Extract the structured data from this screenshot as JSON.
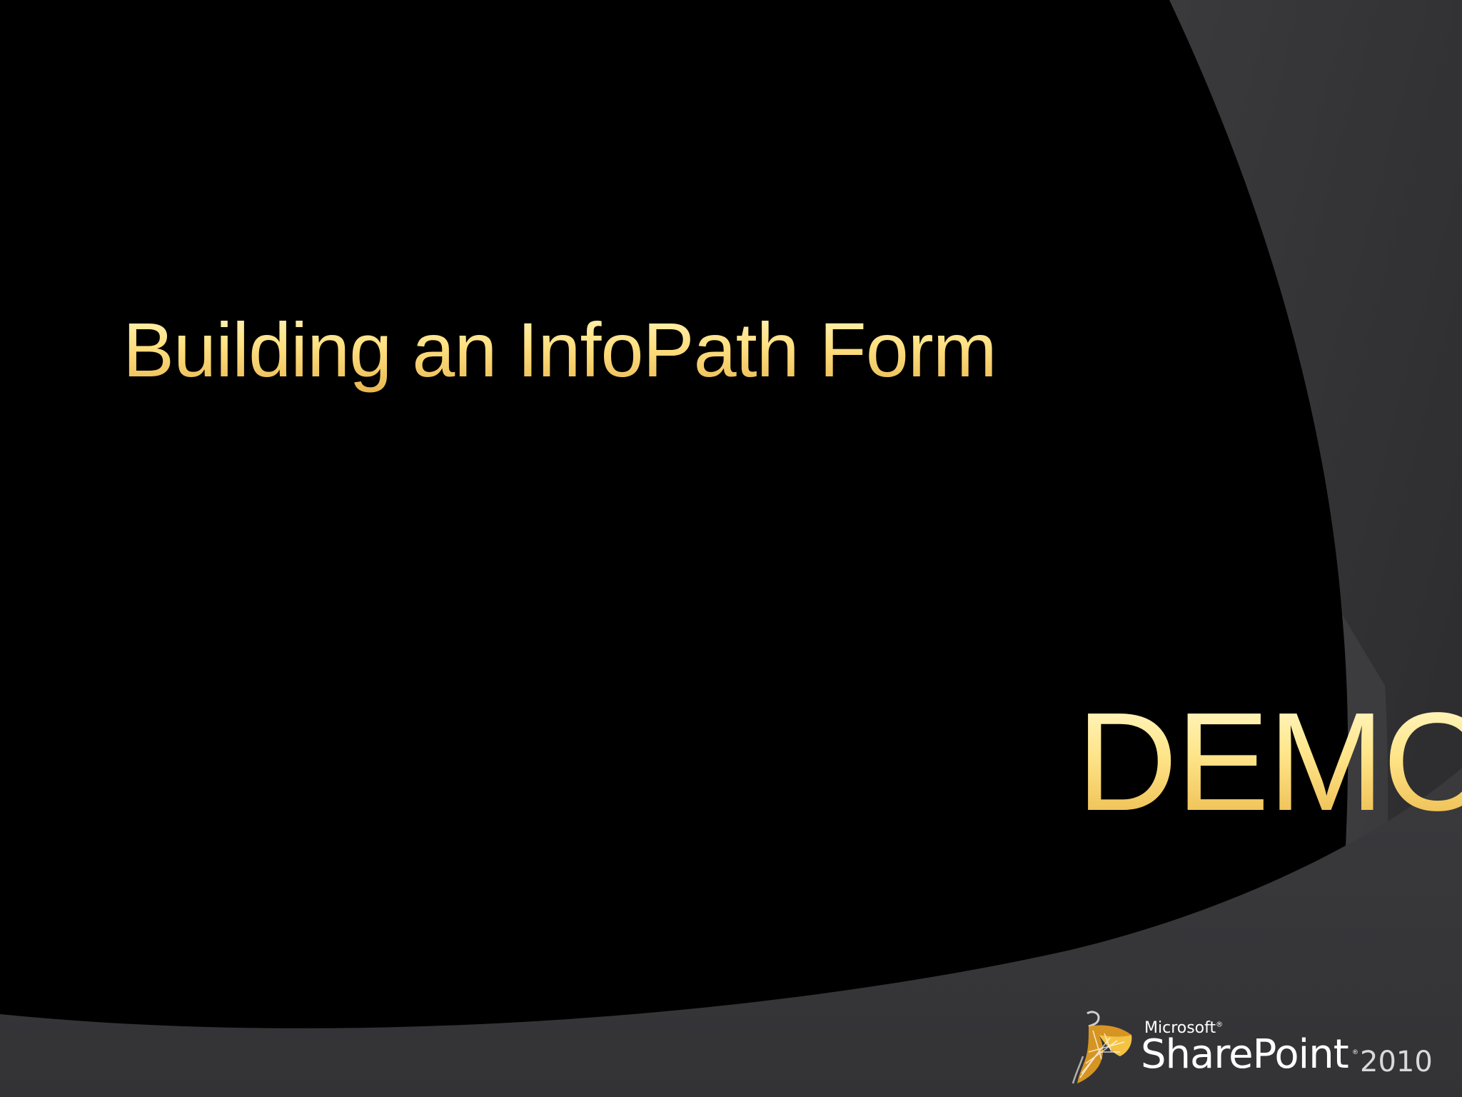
{
  "slide": {
    "title": "Building an InfoPath Form",
    "demo_label": "DEMO"
  },
  "logo": {
    "company": "Microsoft",
    "registered_mark": "®",
    "product": "SharePoint",
    "trademark": "®",
    "year": "2010",
    "icon": "sharepoint-logo-icon"
  },
  "colors": {
    "background": "#000000",
    "swoosh_dark": "#2a2a2c",
    "swoosh_light": "#3c3c3e",
    "title_gold_top": "#fff8c2",
    "title_gold_bottom": "#e6b44a"
  }
}
